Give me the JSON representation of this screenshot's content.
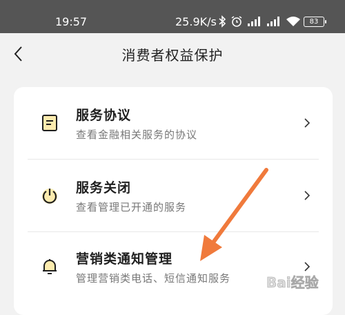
{
  "status_bar": {
    "time": "19:57",
    "net_speed": "25.9K/s",
    "icons": [
      "bluetooth-icon",
      "alarm-icon",
      "signal-icon",
      "signal-icon",
      "wifi-icon"
    ],
    "battery": "83"
  },
  "header": {
    "title": "消费者权益保护",
    "back_icon": "chevron-left-icon"
  },
  "menu": {
    "items": [
      {
        "title": "服务协议",
        "desc": "查看金融相关服务的协议",
        "icon": "document-icon"
      },
      {
        "title": "服务关闭",
        "desc": "查看管理已开通的服务",
        "icon": "power-icon"
      },
      {
        "title": "营销类通知管理",
        "desc": "管理营销类电话、短信通知服务",
        "icon": "bell-icon"
      }
    ]
  },
  "colors": {
    "accent": "#f5c518",
    "annotation_arrow": "#f07a3c",
    "status_bar_bg": "#555555",
    "page_bg": "#f2f2f2"
  },
  "watermark": {
    "text": "Bai经验"
  }
}
